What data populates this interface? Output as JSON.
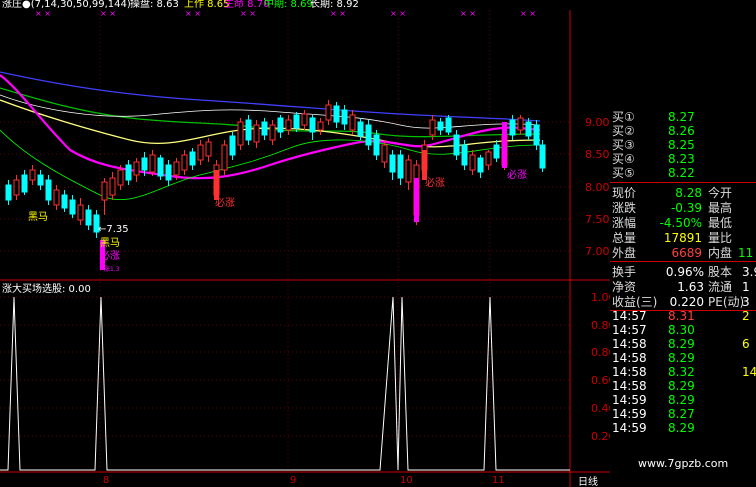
{
  "header": {
    "indicator": "涨庄●(7,14,30,50,99,144)",
    "items": [
      {
        "label": "操盘:",
        "value": "8.63",
        "color": "#ffffff"
      },
      {
        "label": "上作",
        "value": "8.65",
        "color": "#ffff00"
      },
      {
        "label": "生命",
        "value": "8.70",
        "color": "#ff00ff"
      },
      {
        "label": "中期:",
        "value": "8.69",
        "color": "#00ff00"
      },
      {
        "label": "长期:",
        "value": "8.92",
        "color": "#ffffff"
      }
    ]
  },
  "price_axis": [
    "9.00",
    "8.50",
    "8.00",
    "7.50",
    "7.00"
  ],
  "annotations": {
    "heima": "黑马",
    "heima2": "黑马",
    "low_price": "←7.35",
    "bizhang1": "必涨",
    "bizhang2": "必涨",
    "bizhang3": "必涨",
    "bizhang4": "必涨",
    "tiny_label": "涨1.3"
  },
  "sub_panel": {
    "title": "涨大买场选股: 0.00",
    "axis": [
      "1.00",
      "0.80",
      "0.60",
      "0.40",
      "0.20"
    ]
  },
  "x_axis": {
    "labels": [
      "8",
      "9",
      "10",
      "11"
    ],
    "period": "日线"
  },
  "quote": {
    "bids": [
      {
        "label": "买①",
        "value": "8.27"
      },
      {
        "label": "买②",
        "value": "8.26"
      },
      {
        "label": "买③",
        "value": "8.25"
      },
      {
        "label": "买④",
        "value": "8.23"
      },
      {
        "label": "买⑤",
        "value": "8.22"
      }
    ],
    "stats": [
      {
        "l1": "现价",
        "v1": "8.28",
        "c1": "#00ff00",
        "l2": "今开",
        "v2": ""
      },
      {
        "l1": "涨跌",
        "v1": "-0.39",
        "c1": "#00ff00",
        "l2": "最高",
        "v2": ""
      },
      {
        "l1": "涨幅",
        "v1": "-4.50%",
        "c1": "#00ff00",
        "l2": "最低",
        "v2": ""
      },
      {
        "l1": "总量",
        "v1": "17891",
        "c1": "#ffff00",
        "l2": "量比",
        "v2": ""
      },
      {
        "l1": "外盘",
        "v1": "6689",
        "c1": "#ff4040",
        "l2": "内盘",
        "v2": "11"
      }
    ],
    "fundamentals": [
      {
        "l1": "换手",
        "v1": "0.96%",
        "l2": "股本",
        "v2": "3.9"
      },
      {
        "l1": "净资",
        "v1": "1.63",
        "l2": "流通",
        "v2": "1"
      },
      {
        "l1": "收益(三)",
        "v1": "0.220",
        "l2": "PE(动)",
        "v2": "3"
      }
    ],
    "ticks": [
      {
        "time": "14:57",
        "price": "8.31",
        "vol": "2",
        "pc": "#ff4040"
      },
      {
        "time": "14:57",
        "price": "8.30",
        "vol": "",
        "pc": "#00ff00"
      },
      {
        "time": "14:58",
        "price": "8.29",
        "vol": "6",
        "pc": "#00ff00"
      },
      {
        "time": "14:58",
        "price": "8.29",
        "vol": "",
        "pc": "#00ff00"
      },
      {
        "time": "14:58",
        "price": "8.32",
        "vol": "14",
        "pc": "#00ff00"
      },
      {
        "time": "14:58",
        "price": "8.29",
        "vol": "",
        "pc": "#00ff00"
      },
      {
        "time": "14:59",
        "price": "8.29",
        "vol": "",
        "pc": "#00ff00"
      },
      {
        "time": "14:59",
        "price": "8.27",
        "vol": "",
        "pc": "#00ff00"
      },
      {
        "time": "14:59",
        "price": "8.29",
        "vol": "",
        "pc": "#00ff00"
      }
    ]
  },
  "watermark": "www.7gpzb.com",
  "colors": {
    "up": "#ff3030",
    "down": "#00ffff",
    "ma_long": "#4040ff",
    "ma_life": "#ff00ff",
    "ma_mid": "#00c000",
    "ma_short": "#ffff80",
    "ma_op": "#ffffff",
    "axis": "#cc0000"
  }
}
